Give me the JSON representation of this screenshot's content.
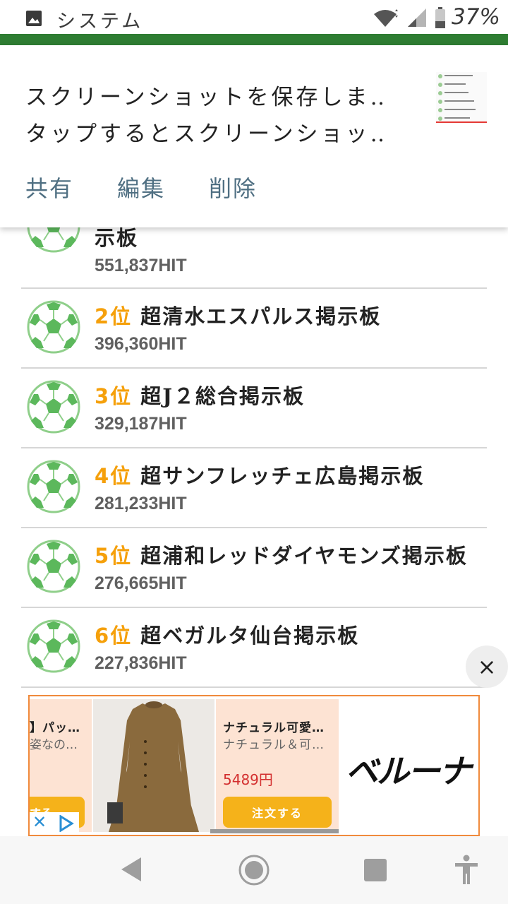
{
  "status_bar": {
    "app_name": "システム",
    "battery_percent": "37%",
    "battery_level": 0.37
  },
  "notification": {
    "line1": "スクリーンショットを保存しま‥",
    "line2": "タップするとスクリーンショッ‥",
    "actions": [
      "共有",
      "編集",
      "削除"
    ]
  },
  "list": {
    "items": [
      {
        "rank": "",
        "title": "示板",
        "hits": "551,837HIT"
      },
      {
        "rank": "2位",
        "title": " 超清水エスパルス掲示板",
        "hits": "396,360HIT"
      },
      {
        "rank": "3位",
        "title": " 超J２総合掲示板",
        "hits": "329,187HIT"
      },
      {
        "rank": "4位",
        "title": " 超サンフレッチェ広島掲示板",
        "hits": "281,233HIT"
      },
      {
        "rank": "5位",
        "title": " 超浦和レッドダイヤモンズ掲示板",
        "hits": "276,665HIT"
      },
      {
        "rank": "6位",
        "title": " 超ベガルタ仙台掲示板",
        "hits": "227,836HIT"
      }
    ]
  },
  "close_label": "×",
  "ad": {
    "card1": {
      "title": "】パッ…",
      "subtitle": "姿なの…",
      "button": "する"
    },
    "card2": {
      "title": "ナチュラル可愛…",
      "subtitle": "ナチュラル＆可…",
      "price": "5489円",
      "button": "注文する"
    },
    "brand": "ベルーナ",
    "close_glyph": "✕"
  },
  "colors": {
    "accent_green": "#2e7d32",
    "rank_orange": "#f5a00b",
    "action_blue": "#4f6f82",
    "ad_border": "#f08a3c",
    "ad_button": "#f5b21a",
    "price_red": "#d32f2f"
  },
  "icons": {
    "status": [
      "image-icon",
      "wifi-icon",
      "signal-icon",
      "battery-icon"
    ],
    "list": "soccer-ball-icon",
    "nav": [
      "back-icon",
      "home-icon",
      "recents-icon",
      "accessibility-icon"
    ]
  }
}
